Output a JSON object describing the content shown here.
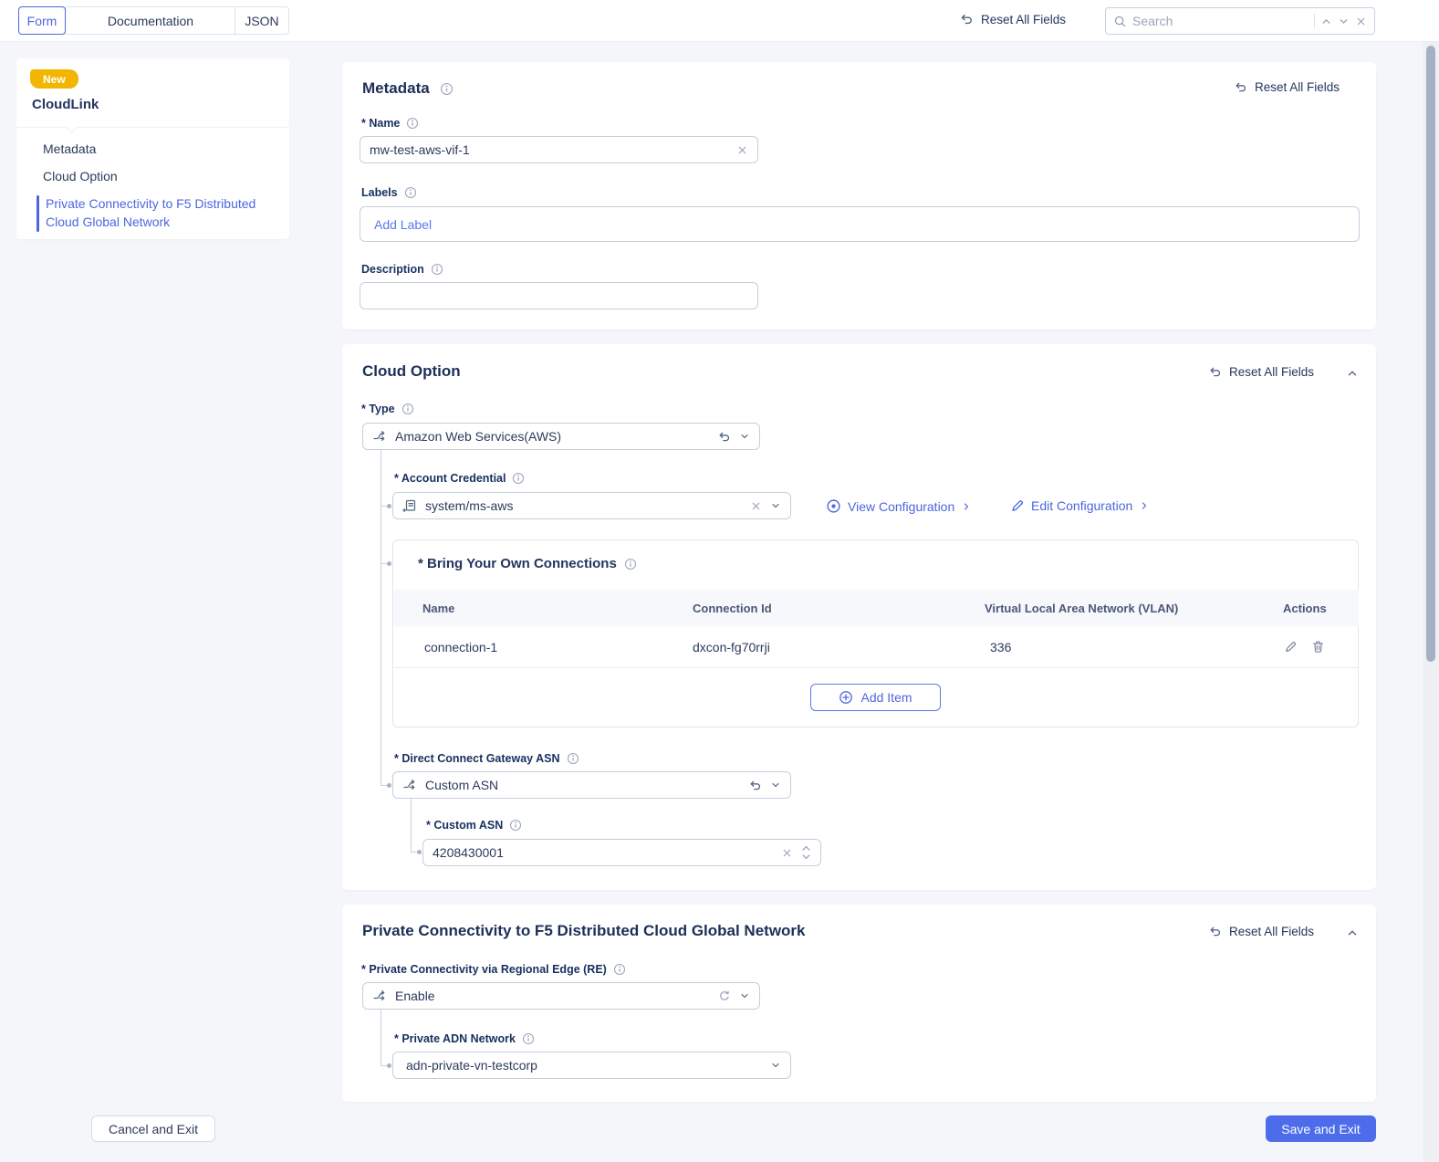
{
  "topbar": {
    "tabs": [
      {
        "label": "Form"
      },
      {
        "label": "Documentation"
      },
      {
        "label": "JSON"
      }
    ],
    "reset_all_label": "Reset All Fields",
    "search": {
      "placeholder": "Search"
    }
  },
  "sidebar": {
    "badge": "New",
    "title": "CloudLink",
    "items": [
      {
        "label": "Metadata"
      },
      {
        "label": "Cloud Option"
      },
      {
        "label": "Private Connectivity to F5 Distributed Cloud Global Network"
      }
    ]
  },
  "metadata_section": {
    "title": "Metadata",
    "reset_label": "Reset All Fields",
    "name_label": "* Name",
    "name_value": "mw-test-aws-vif-1",
    "labels_label": "Labels",
    "add_label_placeholder": "Add Label",
    "description_label": "Description",
    "description_value": ""
  },
  "cloud_option_section": {
    "title": "Cloud Option",
    "reset_label": "Reset All Fields",
    "type_label": "* Type",
    "type_value": "Amazon Web Services(AWS)",
    "account_credential_label": "* Account Credential",
    "account_credential_value": "system/ms-aws",
    "view_configuration_label": "View Configuration",
    "edit_configuration_label": "Edit Configuration",
    "byoc": {
      "title": "* Bring Your Own Connections",
      "columns": [
        "Name",
        "Connection Id",
        "Virtual Local Area Network (VLAN)",
        "Actions"
      ],
      "rows": [
        {
          "name": "connection-1",
          "connection_id": "dxcon-fg70rrji",
          "vlan": "336"
        }
      ],
      "add_item_label": "Add Item"
    },
    "dcgw_asn_label": "* Direct Connect Gateway ASN",
    "dcgw_asn_value": "Custom ASN",
    "custom_asn_label": "* Custom ASN",
    "custom_asn_value": "4208430001"
  },
  "private_connectivity_section": {
    "title": "Private Connectivity to F5 Distributed Cloud Global Network",
    "reset_label": "Reset All Fields",
    "regional_edge_label": "* Private Connectivity via Regional Edge (RE)",
    "regional_edge_value": "Enable",
    "adn_network_label": "* Private ADN Network",
    "adn_network_value": "adn-private-vn-testcorp"
  },
  "footer": {
    "cancel_label": "Cancel and Exit",
    "save_label": "Save and Exit"
  },
  "colors": {
    "primary_blue": "#4d66e0",
    "badge_yellow": "#f2b600",
    "text_navy": "#22355f",
    "border": "#c6cede",
    "page_bg": "#f5f6fa"
  }
}
